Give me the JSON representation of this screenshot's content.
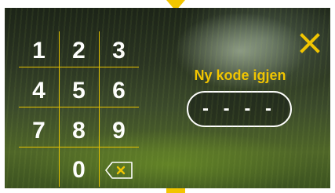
{
  "keypad": {
    "keys": [
      "1",
      "2",
      "3",
      "4",
      "5",
      "6",
      "7",
      "8",
      "9",
      "0"
    ],
    "backspace_icon": "backspace-x-icon"
  },
  "prompt": {
    "label": "Ny kode igjen"
  },
  "code_field": {
    "value": "- - - -"
  },
  "close_icon": "close-x-icon",
  "colors": {
    "accent": "#f2c500",
    "text": "#ffffff"
  }
}
